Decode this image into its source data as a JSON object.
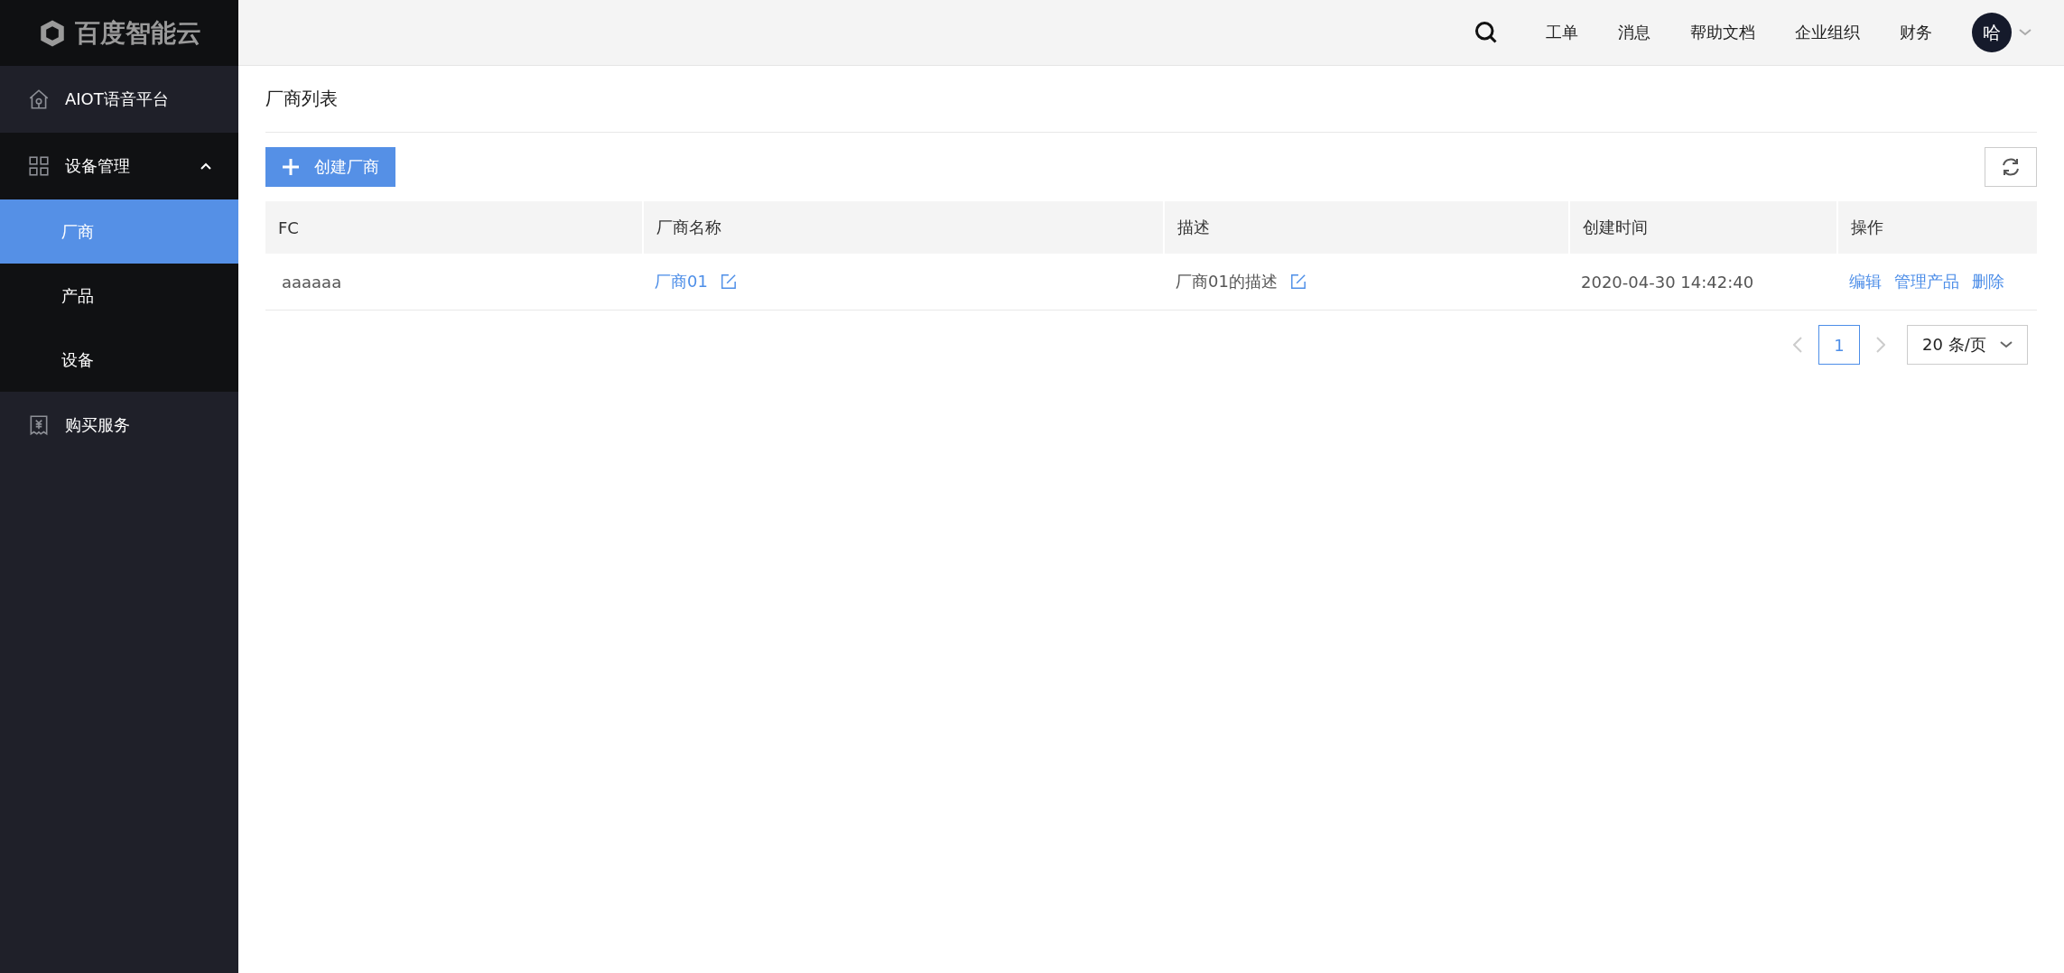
{
  "logo": {
    "text": "百度智能云"
  },
  "sidebar": {
    "items": [
      {
        "label": "AIOT语音平台",
        "kind": "link",
        "selected": false
      },
      {
        "label": "设备管理",
        "kind": "group",
        "expanded": true,
        "selected": false,
        "children": [
          {
            "label": "厂商",
            "selected": true
          },
          {
            "label": "产品",
            "selected": false
          },
          {
            "label": "设备",
            "selected": false
          }
        ]
      },
      {
        "label": "购买服务",
        "kind": "link",
        "selected": false
      }
    ]
  },
  "topbar": {
    "links": [
      "工单",
      "消息",
      "帮助文档",
      "企业组织",
      "财务"
    ],
    "avatar": "哈"
  },
  "page": {
    "title": "厂商列表",
    "create_button": "创建厂商"
  },
  "table": {
    "columns": [
      "FC",
      "厂商名称",
      "描述",
      "创建时间",
      "操作"
    ],
    "rows": [
      {
        "fc": "aaaaaa",
        "name": "厂商01",
        "description": "厂商01的描述",
        "created": "2020-04-30 14:42:40",
        "actions": [
          "编辑",
          "管理产品",
          "删除"
        ]
      }
    ]
  },
  "pagination": {
    "pages": [
      {
        "label": "1",
        "selected": true
      }
    ],
    "page_size": "20 条/页"
  }
}
